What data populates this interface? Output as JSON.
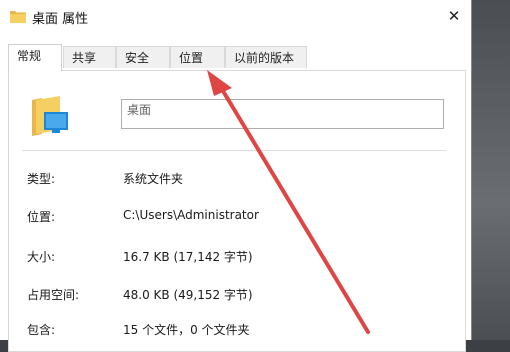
{
  "window": {
    "title": "桌面 属性",
    "close_symbol": "✕"
  },
  "tabs": [
    {
      "label": "常规",
      "active": true
    },
    {
      "label": "共享",
      "active": false
    },
    {
      "label": "安全",
      "active": false
    },
    {
      "label": "位置",
      "active": false
    },
    {
      "label": "以前的版本",
      "active": false
    }
  ],
  "general": {
    "name_value": "桌面",
    "rows": [
      {
        "label": "类型:",
        "value": "系统文件夹"
      },
      {
        "label": "位置:",
        "value": "C:\\Users\\Administrator"
      },
      {
        "label": "大小:",
        "value": "16.7 KB (17,142 字节)"
      },
      {
        "label": "占用空间:",
        "value": "48.0 KB (49,152 字节)"
      },
      {
        "label": "包含:",
        "value": "15 个文件，0 个文件夹"
      }
    ]
  },
  "icons": {
    "title_icon": "folder-icon",
    "main_icon": "desktop-folder-icon",
    "annotation": "red-arrow"
  },
  "colors": {
    "arrow": "#e04545",
    "folder": "#f1c453",
    "desktop_blue": "#1e88d8"
  }
}
